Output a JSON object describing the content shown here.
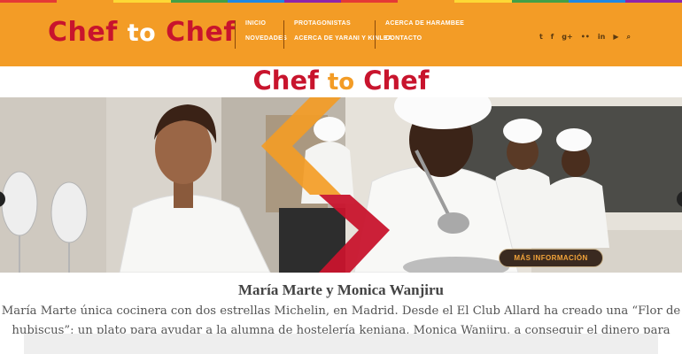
{
  "colors": {
    "header_bg": "#f39c26",
    "brand_red": "#c8142d",
    "brand_orange": "#f39c26",
    "button_bg": "#3a2a20",
    "button_text": "#f3a43a",
    "rainbow": [
      "#e53935",
      "#f39c26",
      "#fdd835",
      "#43a047",
      "#1e88e5",
      "#8e24aa",
      "#e53935",
      "#f39c26",
      "#fdd835",
      "#43a047",
      "#1e88e5",
      "#8e24aa"
    ]
  },
  "header": {
    "logo": {
      "part1": "Chef",
      "part2": "to",
      "part3": "Chef"
    },
    "nav": [
      {
        "label": "INICIO"
      },
      {
        "label": "NOVEDADES"
      },
      {
        "label": "PROTAGONISTAS"
      },
      {
        "label": "ACERCA DE YARANI Y KINLEA"
      },
      {
        "label": "ACERCA DE HARAMBEE"
      },
      {
        "label": "CONTACTO"
      }
    ],
    "social": [
      {
        "icon": "twitter-icon",
        "glyph": "t"
      },
      {
        "icon": "facebook-icon",
        "glyph": "f"
      },
      {
        "icon": "google-plus-icon",
        "glyph": "g+"
      },
      {
        "icon": "flickr-icon",
        "glyph": "••"
      },
      {
        "icon": "linkedin-icon",
        "glyph": "in"
      },
      {
        "icon": "youtube-icon",
        "glyph": "▶"
      },
      {
        "icon": "search-icon",
        "glyph": "⌕"
      }
    ]
  },
  "banner": {
    "title": {
      "part1": "Chef",
      "part2": "to",
      "part3": "Chef"
    },
    "button_label": "MÁS INFORMACIÓN"
  },
  "article": {
    "headline": "María Marte y Monica Wanjiru",
    "body": "María Marte única cocinera con dos estrellas Michelin, en Madrid. Desde el El Club Allard ha creado una “Flor de hubiscus”; un plato para ayudar a la alumna de hostelería keniana, Monica Wanjiru, a conseguir el dinero para completar sus estudios."
  }
}
